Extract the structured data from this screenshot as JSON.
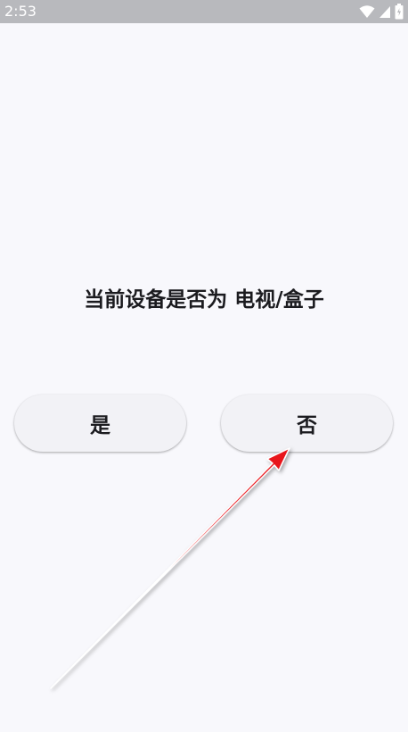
{
  "status_bar": {
    "time": "2:53",
    "icons": [
      "wifi-icon",
      "signal-icon",
      "battery-icon"
    ]
  },
  "dialog": {
    "question": "当前设备是否为 电视/盒子",
    "yes_label": "是",
    "no_label": "否"
  },
  "colors": {
    "status_bar_bg": "#b8b9bd",
    "page_bg": "#f8f8fc",
    "button_bg": "#f2f2f6",
    "text": "#1b1b1f",
    "arrow": "#e8141c"
  },
  "annotation": {
    "arrow": "red-arrow-pointing-to-no-button"
  }
}
